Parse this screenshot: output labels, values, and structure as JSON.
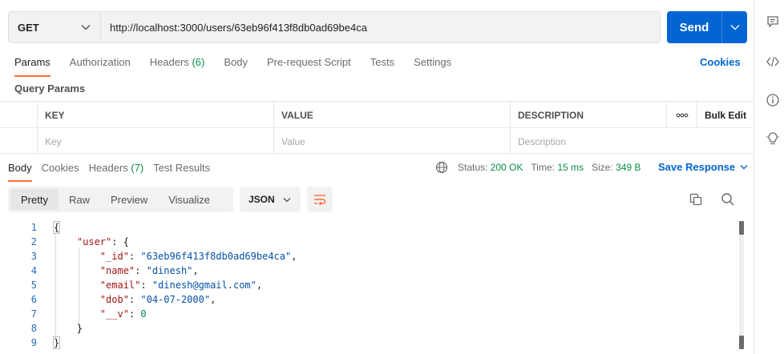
{
  "request": {
    "method": "GET",
    "url": "http://localhost:3000/users/63eb96f413f8db0ad69be4ca",
    "send_label": "Send"
  },
  "request_tabs": [
    {
      "label": "Params",
      "active": true
    },
    {
      "label": "Authorization"
    },
    {
      "label": "Headers",
      "count": "(6)"
    },
    {
      "label": "Body"
    },
    {
      "label": "Pre-request Script"
    },
    {
      "label": "Tests"
    },
    {
      "label": "Settings"
    }
  ],
  "cookies_link": "Cookies",
  "query_params": {
    "title": "Query Params",
    "headers": [
      "KEY",
      "VALUE",
      "DESCRIPTION"
    ],
    "more_label": "ooo",
    "bulk_edit": "Bulk Edit",
    "placeholders": {
      "key": "Key",
      "value": "Value",
      "description": "Description"
    }
  },
  "response_tabs": [
    {
      "label": "Body",
      "active": true
    },
    {
      "label": "Cookies"
    },
    {
      "label": "Headers",
      "count": "(7)"
    },
    {
      "label": "Test Results"
    }
  ],
  "response_status": {
    "status_label": "Status:",
    "status_value": "200 OK",
    "time_label": "Time:",
    "time_value": "15 ms",
    "size_label": "Size:",
    "size_value": "349 B",
    "save_response": "Save Response"
  },
  "view_modes": [
    {
      "label": "Pretty",
      "active": true
    },
    {
      "label": "Raw"
    },
    {
      "label": "Preview"
    },
    {
      "label": "Visualize"
    }
  ],
  "format": "JSON",
  "code_lines": [
    {
      "n": "1",
      "parts": [
        [
          "p",
          "{"
        ]
      ]
    },
    {
      "n": "2",
      "parts": [
        [
          "p",
          "    "
        ],
        [
          "k",
          "\"user\""
        ],
        [
          "p",
          ": {"
        ]
      ]
    },
    {
      "n": "3",
      "parts": [
        [
          "p",
          "        "
        ],
        [
          "k",
          "\"_id\""
        ],
        [
          "p",
          ": "
        ],
        [
          "s",
          "\"63eb96f413f8db0ad69be4ca\""
        ],
        [
          "p",
          ","
        ]
      ]
    },
    {
      "n": "4",
      "parts": [
        [
          "p",
          "        "
        ],
        [
          "k",
          "\"name\""
        ],
        [
          "p",
          ": "
        ],
        [
          "s",
          "\"dinesh\""
        ],
        [
          "p",
          ","
        ]
      ]
    },
    {
      "n": "5",
      "parts": [
        [
          "p",
          "        "
        ],
        [
          "k",
          "\"email\""
        ],
        [
          "p",
          ": "
        ],
        [
          "s",
          "\"dinesh@gmail.com\""
        ],
        [
          "p",
          ","
        ]
      ]
    },
    {
      "n": "6",
      "parts": [
        [
          "p",
          "        "
        ],
        [
          "k",
          "\"dob\""
        ],
        [
          "p",
          ": "
        ],
        [
          "s",
          "\"04-07-2000\""
        ],
        [
          "p",
          ","
        ]
      ]
    },
    {
      "n": "7",
      "parts": [
        [
          "p",
          "        "
        ],
        [
          "k",
          "\"__v\""
        ],
        [
          "p",
          ": "
        ],
        [
          "n",
          "0"
        ]
      ]
    },
    {
      "n": "8",
      "parts": [
        [
          "p",
          "    }"
        ]
      ]
    },
    {
      "n": "9",
      "parts": [
        [
          "p",
          "}"
        ]
      ]
    }
  ],
  "icons": {
    "right_rail": [
      "comment-icon",
      "code-icon",
      "info-icon",
      "lightbulb-icon"
    ],
    "toolbar": [
      "copy-icon",
      "search-icon"
    ],
    "globe": "globe-icon",
    "wrap": "wrap-lines-icon"
  },
  "colors": {
    "send": "#0265d2",
    "active_tab_underline": "#ff6c37",
    "status_green": "#0a8c4a",
    "link_blue": "#0265d2"
  }
}
